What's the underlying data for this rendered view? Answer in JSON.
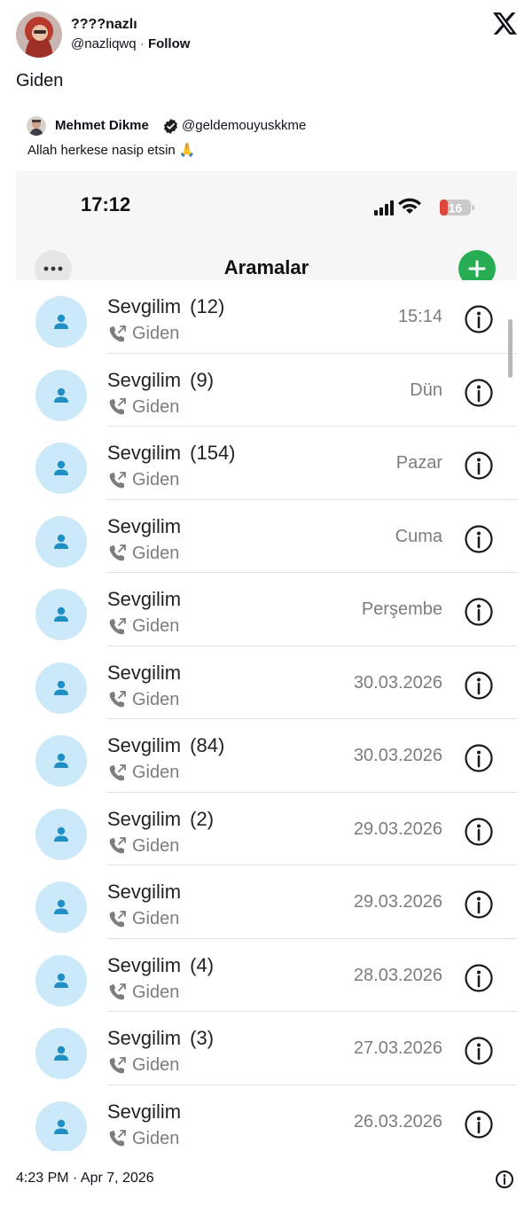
{
  "tweet": {
    "author_name": "????nazlı",
    "author_handle": "@nazliqwq",
    "separator": "·",
    "follow_label": "Follow",
    "text": "Giden",
    "timestamp": "4:23 PM · Apr 7, 2026"
  },
  "quote": {
    "name": "Mehmet Dikme",
    "handle": "@geldemouyuskkme",
    "text": "Allah herkese nasip etsin 🙏"
  },
  "phone": {
    "status_time": "17:12",
    "battery_level": "16",
    "nav_title": "Aramalar",
    "calls": [
      {
        "name": "Sevgilim",
        "count": "(12)",
        "type": "Giden",
        "date": "15:14"
      },
      {
        "name": "Sevgilim",
        "count": "(9)",
        "type": "Giden",
        "date": "Dün"
      },
      {
        "name": "Sevgilim",
        "count": "(154)",
        "type": "Giden",
        "date": "Pazar"
      },
      {
        "name": "Sevgilim",
        "count": "",
        "type": "Giden",
        "date": "Cuma"
      },
      {
        "name": "Sevgilim",
        "count": "",
        "type": "Giden",
        "date": "Perşembe"
      },
      {
        "name": "Sevgilim",
        "count": "",
        "type": "Giden",
        "date": "30.03.2026"
      },
      {
        "name": "Sevgilim",
        "count": "(84)",
        "type": "Giden",
        "date": "30.03.2026"
      },
      {
        "name": "Sevgilim",
        "count": "(2)",
        "type": "Giden",
        "date": "29.03.2026"
      },
      {
        "name": "Sevgilim",
        "count": "",
        "type": "Giden",
        "date": "29.03.2026"
      },
      {
        "name": "Sevgilim",
        "count": "(4)",
        "type": "Giden",
        "date": "28.03.2026"
      },
      {
        "name": "Sevgilim",
        "count": "(3)",
        "type": "Giden",
        "date": "27.03.2026"
      },
      {
        "name": "Sevgilim",
        "count": "",
        "type": "Giden",
        "date": "26.03.2026"
      }
    ]
  },
  "colors": {
    "add_button": "#27ae55",
    "avatar_bg": "#cbe9f8",
    "avatar_icon": "#1f8fc4",
    "battery_red": "#e0463b"
  },
  "icons": {
    "x_logo": "x-logo-icon",
    "verified": "verified-badge-icon",
    "more": "ellipsis-icon",
    "add": "plus-icon",
    "contact": "person-icon",
    "outgoing_call": "outgoing-call-icon",
    "info": "info-circle-icon"
  }
}
